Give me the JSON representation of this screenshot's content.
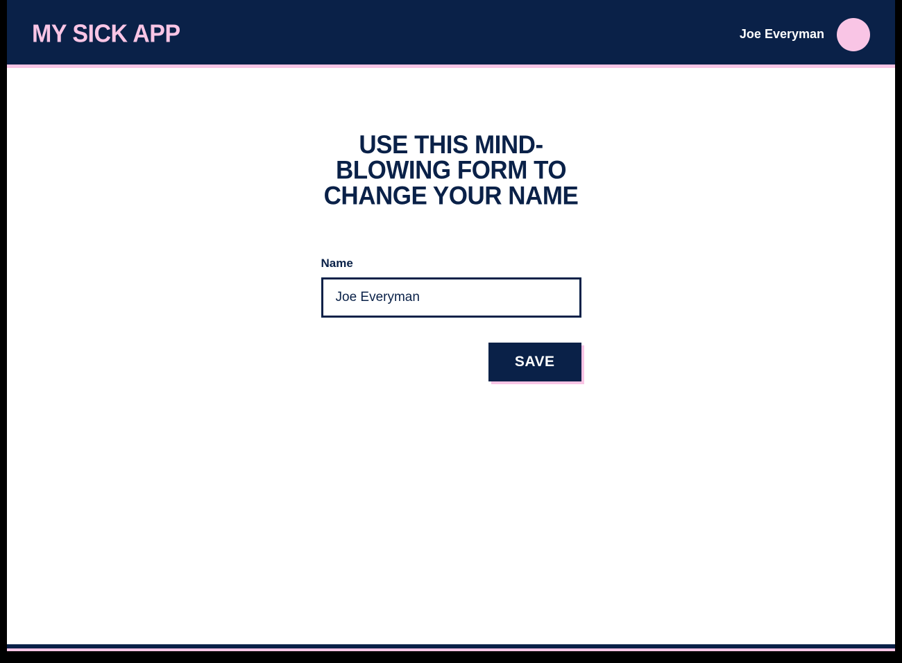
{
  "header": {
    "app_title": "MY SICK APP",
    "user_name": "Joe Everyman"
  },
  "main": {
    "heading": "USE THIS MIND-BLOWING FORM TO CHANGE YOUR NAME",
    "form": {
      "name_label": "Name",
      "name_value": "Joe Everyman",
      "save_label": "SAVE"
    }
  }
}
